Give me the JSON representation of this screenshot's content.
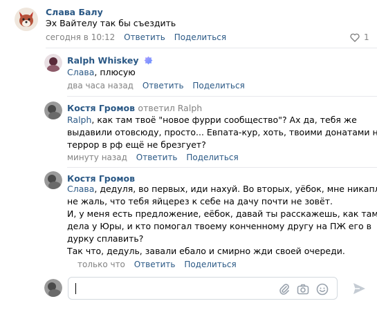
{
  "colors": {
    "link": "#2a5885",
    "meta": "#828282",
    "divider": "#e7e8ec"
  },
  "comments": [
    {
      "author": "Слава Балу",
      "text": "Эх Вайтелу так бы съездить",
      "time": "сегодня в 10:12",
      "reply": "Ответить",
      "share": "Поделиться",
      "likes": "1"
    },
    {
      "author": "Ralph Whiskey",
      "reply_to_name": "Слава",
      "text": ", плюсую",
      "time": "два часа назад",
      "reply": "Ответить",
      "share": "Поделиться"
    },
    {
      "author": "Костя Громов",
      "answered": "ответил Ralph",
      "reply_to_name": "Ralph",
      "lines": [
        ", как там твоё \"новое фурри сообщество\"? Ах да, тебя же",
        "выдавили отовсюду, просто... Евпата-кур, хоть, твоими донатами на",
        "террор в рф ещё не брезгует?"
      ],
      "time": "минуту назад",
      "reply": "Ответить",
      "share": "Поделиться"
    },
    {
      "author": "Костя Громов",
      "reply_to_name": "Слава",
      "lines": [
        ", дедуля, во первых, иди нахуй. Во вторых, уёбок, мне никапли",
        "не жаль, что тебя яйцерез к себе на дачу почти не зовёт.",
        "И, у меня есть предложение, еёбок, давай ты расскажешь, как там",
        "дела у Юры, и кто помогал твоему конченному другу на ПЖ его в",
        "дурку сплавить?",
        "Так что, дедуль, завали ебало и смирно жди своей очереди."
      ],
      "time": "только что",
      "reply": "Ответить",
      "share": "Поделиться"
    }
  ],
  "composer": {
    "icons": [
      "paperclip-icon",
      "camera-icon",
      "emoji-icon",
      "send-icon"
    ]
  }
}
